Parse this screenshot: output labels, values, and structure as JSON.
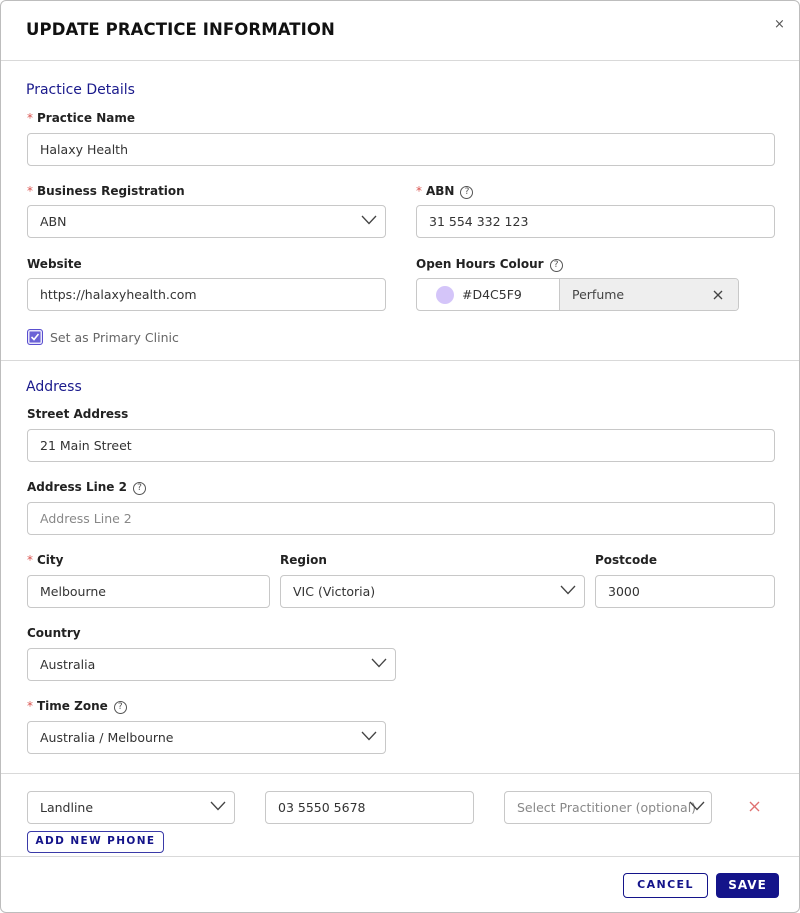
{
  "dialog": {
    "title": "UPDATE PRACTICE INFORMATION",
    "close_glyph": "×"
  },
  "practice_details": {
    "section_title": "Practice Details",
    "practice_name": {
      "label": "Practice Name",
      "required": "*",
      "value": "Halaxy Health"
    },
    "business_registration": {
      "label": "Business Registration",
      "required": "*",
      "value": "ABN"
    },
    "abn": {
      "label": "ABN",
      "required": "*",
      "value": "31 554 332 123"
    },
    "website": {
      "label": "Website",
      "value": "https://halaxyhealth.com"
    },
    "open_hours_colour": {
      "label": "Open Hours Colour",
      "hex": "#D4C5F9",
      "name": "Perfume",
      "swatch_color": "#D4C5F9"
    },
    "primary_clinic": {
      "label": "Set as Primary Clinic",
      "checked": true
    }
  },
  "address": {
    "section_title": "Address",
    "street": {
      "label": "Street Address",
      "value": "21 Main Street"
    },
    "line2": {
      "label": "Address Line 2",
      "placeholder": "Address Line 2"
    },
    "city": {
      "label": "City",
      "required": "*",
      "value": "Melbourne"
    },
    "region": {
      "label": "Region",
      "value": "VIC (Victoria)"
    },
    "postcode": {
      "label": "Postcode",
      "value": "3000"
    },
    "country": {
      "label": "Country",
      "value": "Australia"
    },
    "timezone": {
      "label": "Time Zone",
      "required": "*",
      "value": "Australia / Melbourne"
    }
  },
  "phones": {
    "rows": [
      {
        "type": "Landline",
        "number": "03 5550 5678",
        "practitioner_placeholder": "Select Practitioner (optional)"
      }
    ],
    "add_label": "ADD NEW PHONE"
  },
  "footer": {
    "cancel_label": "CANCEL",
    "save_label": "SAVE"
  },
  "colors": {
    "accent": "#14148a",
    "section_title": "#1a1a8c",
    "required": "#d9534f",
    "remove_icon": "#e07070"
  },
  "icons": {
    "help": "?",
    "clear": "×"
  }
}
